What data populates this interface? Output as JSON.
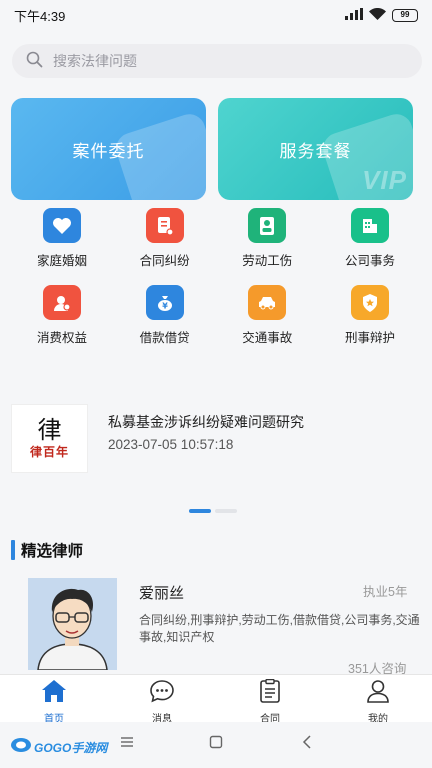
{
  "status_bar": {
    "time": "下午4:39",
    "battery": "99"
  },
  "search": {
    "placeholder": "搜索法律问题"
  },
  "banners": [
    {
      "label": "案件委托",
      "deco": ""
    },
    {
      "label": "服务套餐",
      "deco": "VIP"
    }
  ],
  "categories": [
    {
      "label": "家庭婚姻",
      "color": "#2e86de",
      "icon": "heart-icon"
    },
    {
      "label": "合同纠纷",
      "color": "#f0533f",
      "icon": "contract-icon"
    },
    {
      "label": "劳动工伤",
      "color": "#1fb37a",
      "icon": "worker-icon"
    },
    {
      "label": "公司事务",
      "color": "#19c08a",
      "icon": "building-icon"
    },
    {
      "label": "消费权益",
      "color": "#f0533f",
      "icon": "consumer-icon"
    },
    {
      "label": "借款借贷",
      "color": "#2e86de",
      "icon": "money-bag-icon"
    },
    {
      "label": "交通事故",
      "color": "#f59a2b",
      "icon": "car-icon"
    },
    {
      "label": "刑事辩护",
      "color": "#f7a82a",
      "icon": "shield-star-icon"
    }
  ],
  "news": {
    "thumb_big": "律",
    "thumb_small": "律百年",
    "title": "私募基金涉诉纠纷疑难问题研究",
    "date": "2023-07-05 10:57:18"
  },
  "section": {
    "title": "精选律师"
  },
  "lawyer": {
    "name": "爱丽丝",
    "experience": "执业5年",
    "tags": "合同纠纷,刑事辩护,劳动工伤,借款借贷,公司事务,交通事故,知识产权",
    "count": "351人咨询"
  },
  "tabs": [
    {
      "label": "首页",
      "icon": "home-icon"
    },
    {
      "label": "消息",
      "icon": "message-icon"
    },
    {
      "label": "合同",
      "icon": "document-icon"
    },
    {
      "label": "我的",
      "icon": "user-icon"
    }
  ],
  "watermark": {
    "text": "GOGO手游网"
  },
  "colors": {
    "accent": "#2e86de",
    "tab_active": "#1e6fd0"
  }
}
